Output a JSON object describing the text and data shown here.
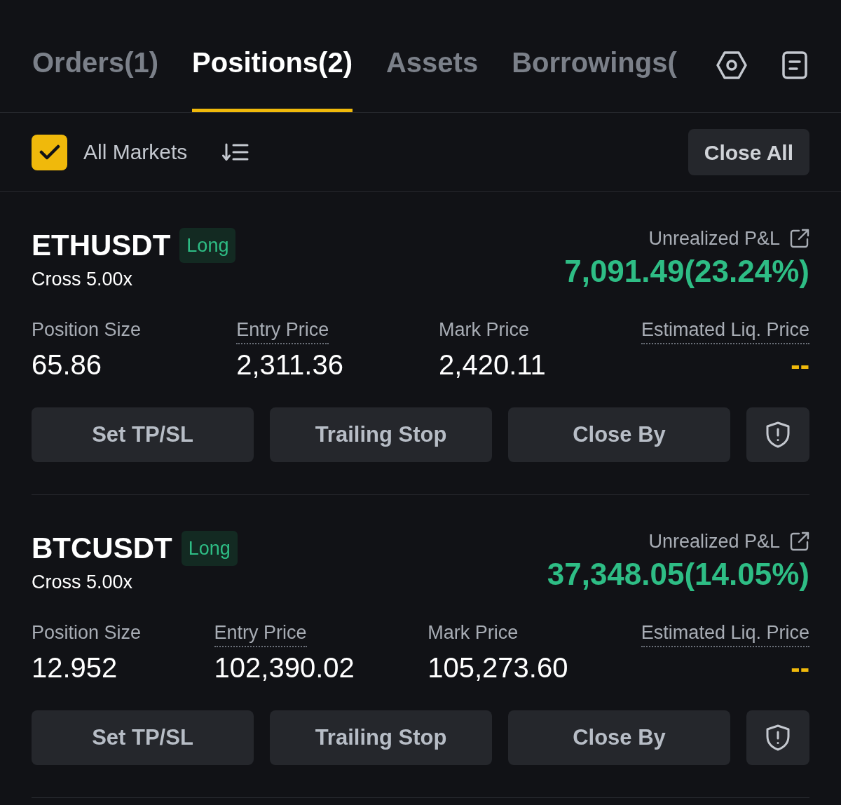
{
  "tabs": [
    {
      "label": "Orders(1)",
      "selected": false
    },
    {
      "label": "Positions(2)",
      "selected": true
    },
    {
      "label": "Assets",
      "selected": false
    },
    {
      "label": "Borrowings(",
      "selected": false
    }
  ],
  "toolbar": {
    "all_markets": {
      "label": "All Markets",
      "checked": true
    },
    "close_all": "Close All"
  },
  "positions": [
    {
      "symbol": "ETHUSDT",
      "side": {
        "label": "Long",
        "kind": "long"
      },
      "margin": "Cross 5.00x",
      "pnl_label": "Unrealized P&L",
      "pnl": "7,091.49(23.24%)",
      "stats": [
        {
          "label": "Position Size",
          "value": "65.86",
          "dotted": false
        },
        {
          "label": "Entry Price",
          "value": "2,311.36",
          "dotted": true
        },
        {
          "label": "Mark Price",
          "value": "2,420.11",
          "dotted": false
        },
        {
          "label": "Estimated Liq. Price",
          "value": "--",
          "dotted": true
        }
      ],
      "buttons": [
        "Set TP/SL",
        "Trailing Stop",
        "Close By"
      ]
    },
    {
      "symbol": "BTCUSDT",
      "side": {
        "label": "Long",
        "kind": "long"
      },
      "margin": "Cross 5.00x",
      "pnl_label": "Unrealized P&L",
      "pnl": "37,348.05(14.05%)",
      "stats": [
        {
          "label": "Position Size",
          "value": "12.952",
          "dotted": false
        },
        {
          "label": "Entry Price",
          "value": "102,390.02",
          "dotted": true
        },
        {
          "label": "Mark Price",
          "value": "105,273.60",
          "dotted": false
        },
        {
          "label": "Estimated Liq. Price",
          "value": "--",
          "dotted": true
        }
      ],
      "buttons": [
        "Set TP/SL",
        "Trailing Stop",
        "Close By"
      ]
    }
  ]
}
